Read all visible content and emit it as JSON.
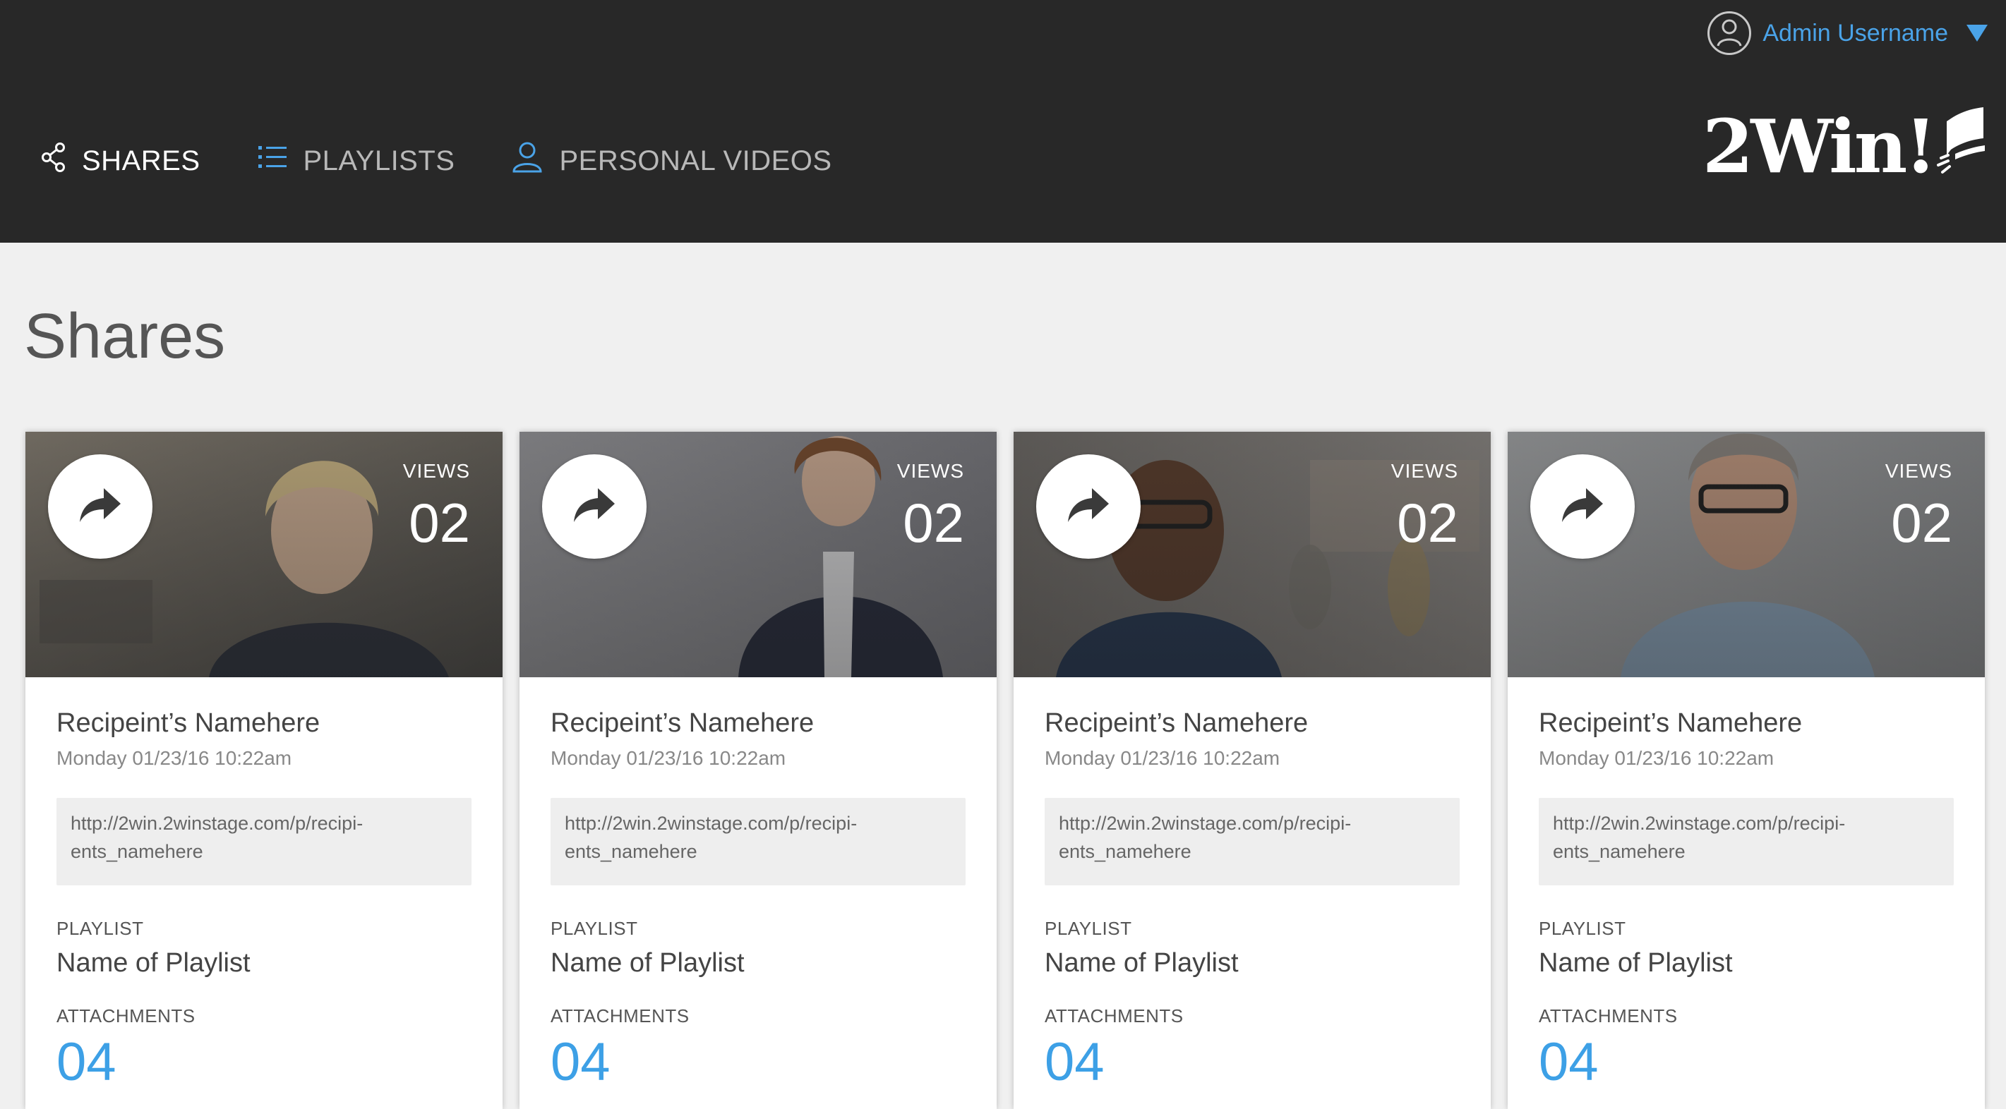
{
  "header": {
    "user_name": "Admin Username",
    "logo_text": "2Win!",
    "nav": [
      {
        "label": "SHARES",
        "icon": "share-icon",
        "active": true
      },
      {
        "label": "PLAYLISTS",
        "icon": "list-icon",
        "active": false
      },
      {
        "label": "PERSONAL VIDEOS",
        "icon": "person-icon",
        "active": false
      }
    ]
  },
  "page": {
    "title": "Shares"
  },
  "colors": {
    "header_bg": "#282828",
    "accent": "#4aa3e8",
    "page_bg": "#f0f0f0"
  },
  "cards": [
    {
      "views_label": "VIEWS",
      "views": "02",
      "recipient": "Recipeint’s Namehere",
      "date": "Monday 01/23/16 10:22am",
      "link_line1": "http://2win.2winstage.com/p/recipi-",
      "link_line2": "ents_namehere",
      "playlist_label": "PLAYLIST",
      "playlist_name": "Name of Playlist",
      "attachments_label": "ATTACHMENTS",
      "attachments": "04"
    },
    {
      "views_label": "VIEWS",
      "views": "02",
      "recipient": "Recipeint’s Namehere",
      "date": "Monday 01/23/16 10:22am",
      "link_line1": "http://2win.2winstage.com/p/recipi-",
      "link_line2": "ents_namehere",
      "playlist_label": "PLAYLIST",
      "playlist_name": "Name of Playlist",
      "attachments_label": "ATTACHMENTS",
      "attachments": "04"
    },
    {
      "views_label": "VIEWS",
      "views": "02",
      "recipient": "Recipeint’s Namehere",
      "date": "Monday 01/23/16 10:22am",
      "link_line1": "http://2win.2winstage.com/p/recipi-",
      "link_line2": "ents_namehere",
      "playlist_label": "PLAYLIST",
      "playlist_name": "Name of Playlist",
      "attachments_label": "ATTACHMENTS",
      "attachments": "04"
    },
    {
      "views_label": "VIEWS",
      "views": "02",
      "recipient": "Recipeint’s Namehere",
      "date": "Monday 01/23/16 10:22am",
      "link_line1": "http://2win.2winstage.com/p/recipi-",
      "link_line2": "ents_namehere",
      "playlist_label": "PLAYLIST",
      "playlist_name": "Name of Playlist",
      "attachments_label": "ATTACHMENTS",
      "attachments": "04"
    }
  ]
}
